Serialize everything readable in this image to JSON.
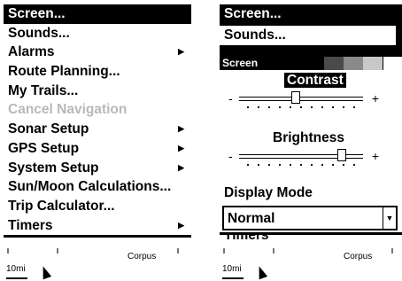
{
  "left": {
    "menu": [
      {
        "label": "Screen...",
        "selected": true,
        "disabled": false,
        "submenu": false
      },
      {
        "label": "Sounds...",
        "selected": false,
        "disabled": false,
        "submenu": false
      },
      {
        "label": "Alarms",
        "selected": false,
        "disabled": false,
        "submenu": true
      },
      {
        "label": "Route Planning...",
        "selected": false,
        "disabled": false,
        "submenu": false
      },
      {
        "label": "My Trails...",
        "selected": false,
        "disabled": false,
        "submenu": false
      },
      {
        "label": "Cancel Navigation",
        "selected": false,
        "disabled": true,
        "submenu": false
      },
      {
        "label": "Sonar Setup",
        "selected": false,
        "disabled": false,
        "submenu": true
      },
      {
        "label": "GPS Setup",
        "selected": false,
        "disabled": false,
        "submenu": true
      },
      {
        "label": "System Setup",
        "selected": false,
        "disabled": false,
        "submenu": true
      },
      {
        "label": "Sun/Moon Calculations...",
        "selected": false,
        "disabled": false,
        "submenu": false
      },
      {
        "label": "Trip Calculator...",
        "selected": false,
        "disabled": false,
        "submenu": false
      },
      {
        "label": "Timers",
        "selected": false,
        "disabled": false,
        "submenu": true
      }
    ],
    "map": {
      "scale": "10mi",
      "place": "Corpus"
    }
  },
  "right": {
    "menu_top": [
      "Screen...",
      "Sounds..."
    ],
    "dialog": {
      "title": "Screen",
      "swatch_colors": [
        "#4a4a4a",
        "#8a8a8a",
        "#c8c8c8",
        "#ffffff"
      ],
      "contrast_label": "Contrast",
      "contrast_value": 0.45,
      "brightness_label": "Brightness",
      "brightness_value": 0.85,
      "slider_minus": "-",
      "slider_plus": "+",
      "display_mode_label": "Display Mode",
      "display_mode_value": "Normal"
    },
    "covered_item": "Timers",
    "map": {
      "scale": "10mi",
      "place": "Corpus"
    }
  },
  "icons": {
    "submenu_arrow": "▶",
    "dropdown_arrow": "▼"
  }
}
